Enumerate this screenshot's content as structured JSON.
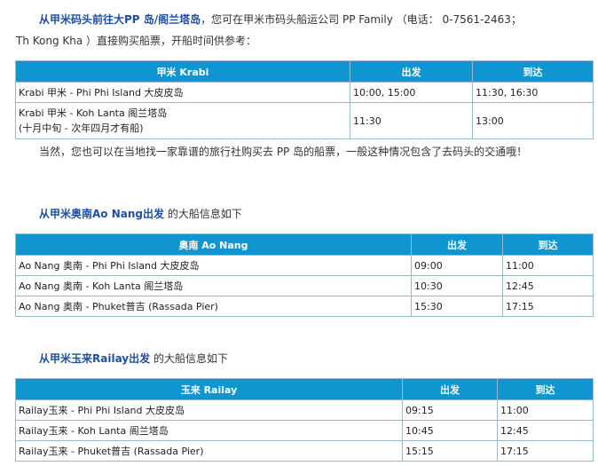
{
  "intro": {
    "link": "从甲米码头前往大PP 岛/阁兰塔岛",
    "text1": "，您可在甲米市码头船运公司 PP Family （电话： 0-7561-2463；",
    "text2": "Th Kong Kha ）直接购买船票，开船时间供参考："
  },
  "krabi_table": {
    "headers": [
      "甲米 Krabi",
      "出发",
      "到达"
    ],
    "rows": [
      {
        "route": "Krabi 甲米 - Phi Phi Island 大皮皮岛",
        "route_note": "",
        "depart": "10:00, 15:00",
        "arrive": "11:30, 16:30"
      },
      {
        "route": "Krabi 甲米 - Koh Lanta 阁兰塔岛",
        "route_note": "(十月中旬 - 次年四月才有船)",
        "depart": "11:30",
        "arrive": "13:00"
      }
    ]
  },
  "note": "当然，您也可以在当地找一家靠谱的旅行社购买去 PP 岛的船票，一般这种情况包含了去码头的交通哦！",
  "aonang": {
    "heading_link": "从甲米奥南Ao Nang出发",
    "heading_text": "的大船信息如下",
    "headers": [
      "奥南 Ao Nang",
      "出发",
      "到达"
    ],
    "rows": [
      {
        "route": "Ao Nang 奥南 - Phi Phi Island 大皮皮岛",
        "depart": "09:00",
        "arrive": "11:00"
      },
      {
        "route": "Ao Nang 奥南 - Koh Lanta 阁兰塔岛",
        "depart": "10:30",
        "arrive": "12:45"
      },
      {
        "route": "Ao Nang 奥南 - Phuket普吉 (Rassada Pier)",
        "depart": "15:30",
        "arrive": "17:15"
      }
    ]
  },
  "railay": {
    "heading_link": "从甲米玉来Railay出发",
    "heading_text": "的大船信息如下",
    "headers": [
      "玉来 Railay",
      "出发",
      "到达"
    ],
    "rows": [
      {
        "route": "Railay玉来 - Phi Phi Island 大皮皮岛",
        "depart": "09:15",
        "arrive": "11:00"
      },
      {
        "route": "Railay玉来 - Koh Lanta 阁兰塔岛",
        "depart": "10:45",
        "arrive": "12:45"
      },
      {
        "route": "Railay玉来 - Phuket普吉 (Rassada Pier)",
        "depart": "15:15",
        "arrive": "17:15"
      }
    ]
  }
}
